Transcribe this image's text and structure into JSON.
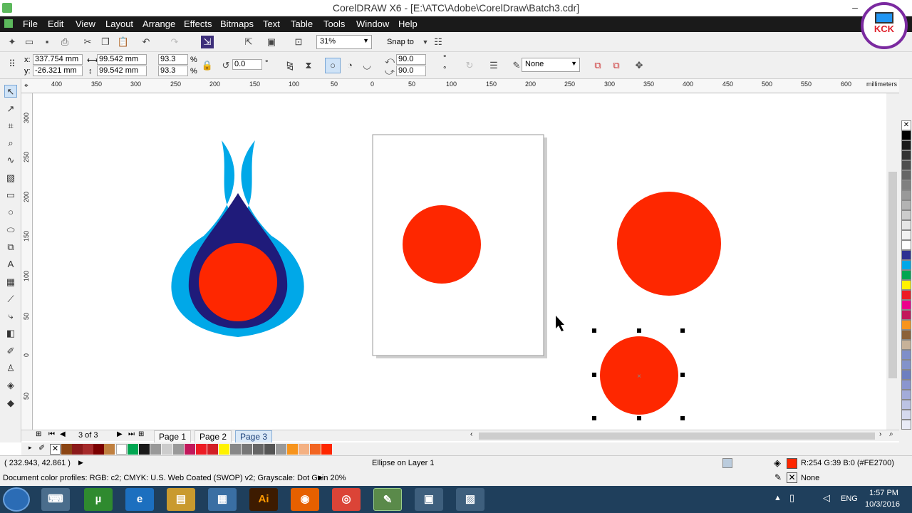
{
  "window": {
    "title": "CorelDRAW X6 - [E:\\ATC\\Adobe\\CorelDraw\\Batch3.cdr]",
    "min": "–",
    "max": "□",
    "close": "✕"
  },
  "menu": [
    "File",
    "Edit",
    "View",
    "Layout",
    "Arrange",
    "Effects",
    "Bitmaps",
    "Text",
    "Table",
    "Tools",
    "Window",
    "Help"
  ],
  "toolbar": {
    "zoom": "31%",
    "snap_to": "Snap to"
  },
  "properties": {
    "x": "337.754 mm",
    "y": "-26.321 mm",
    "width": "99.542 mm",
    "height": "99.542 mm",
    "scale_x": "93.3",
    "scale_y": "93.3",
    "percent": "%",
    "rotation": "0.0",
    "degree": "°",
    "start_angle": "90.0",
    "end_angle": "90.0",
    "outline": "None",
    "x_label": "x:",
    "y_label": "y:"
  },
  "ruler": {
    "unit": "millimeters",
    "h_ticks": [
      "400",
      "350",
      "300",
      "250",
      "200",
      "150",
      "100",
      "50",
      "0",
      "50",
      "100",
      "150",
      "200",
      "250",
      "300",
      "350",
      "400",
      "450",
      "500",
      "550",
      "600"
    ],
    "v_ticks": [
      "300",
      "250",
      "200",
      "150",
      "100",
      "50",
      "0",
      "50"
    ]
  },
  "pages": {
    "count": "3 of 3",
    "tabs": [
      "Page 1",
      "Page 2",
      "Page 3"
    ],
    "active": "Page 3"
  },
  "status": {
    "cursor": "( 232.943, 42.861 )",
    "selection": "Ellipse on Layer 1",
    "fill": "R:254 G:39 B:0 (#FE2700)",
    "outline": "None",
    "profiles": "Document color profiles: RGB: c2; CMYK: U.S. Web Coated (SWOP) v2; Grayscale: Dot Gain 20%"
  },
  "taskbar": {
    "lang": "ENG",
    "time": "1:57 PM",
    "date": "10/3/2016"
  },
  "watermark": {
    "text": "KCK"
  },
  "colors": {
    "fill": "#FE2700",
    "droplet_light": "#00a8e8",
    "droplet_dark": "#1f1b7a"
  }
}
